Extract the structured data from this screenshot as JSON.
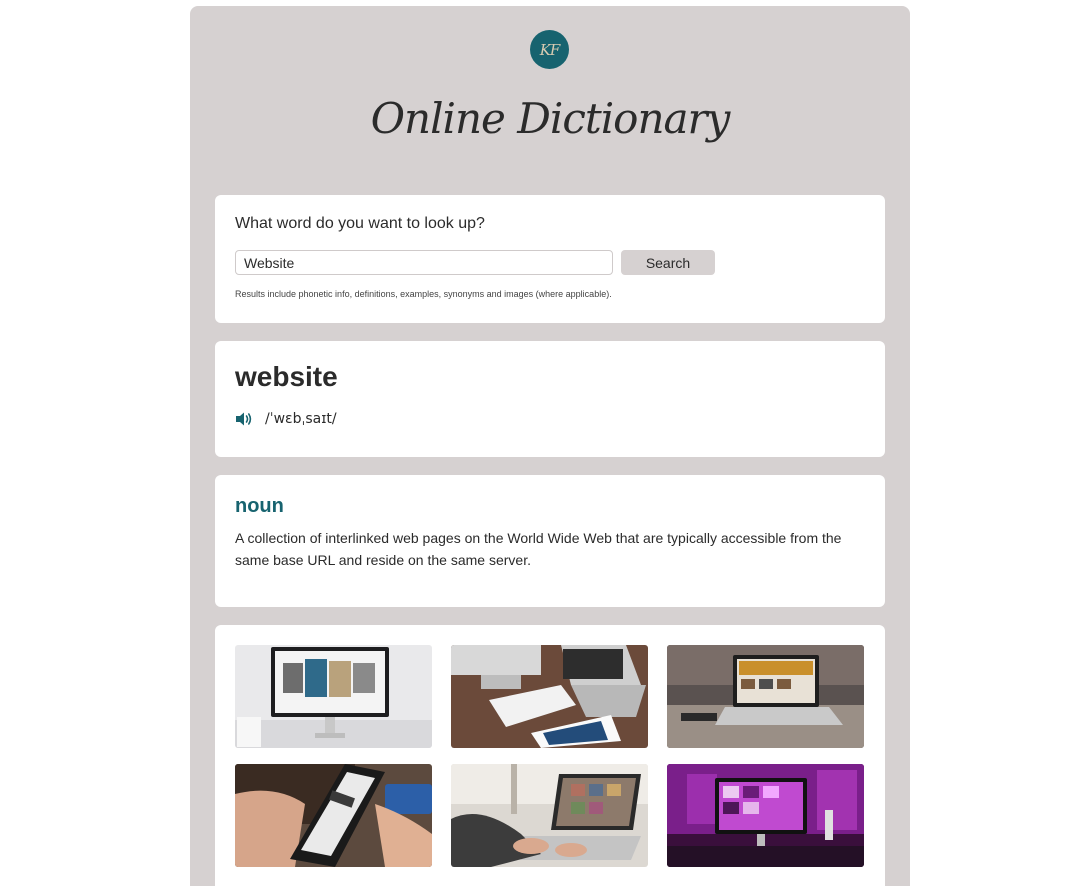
{
  "header": {
    "logo_text": "KF",
    "title": "Online Dictionary"
  },
  "search": {
    "prompt": "What word do you want to look up?",
    "value": "Website",
    "button_label": "Search",
    "hint": "Results include phonetic info, definitions, examples, synonyms and images (where applicable)."
  },
  "result": {
    "word": "website",
    "audio_icon": "speaker-icon",
    "phonetic": "/ˈwɛbˌsaɪt/"
  },
  "meaning": {
    "part_of_speech": "noun",
    "definition": "A collection of interlinked web pages on the World Wide Web that are typically accessible from the same base URL and reside on the same server."
  },
  "images": [
    {
      "name": "photo-monitor-art-gallery"
    },
    {
      "name": "photo-desk-imac-laptop-tablet"
    },
    {
      "name": "photo-laptop-on-wooden-table"
    },
    {
      "name": "photo-phone-online-shopping"
    },
    {
      "name": "photo-hands-typing-laptop"
    },
    {
      "name": "photo-pink-lit-desk-setup"
    }
  ],
  "colors": {
    "accent": "#17636f",
    "panel": "#d6d1d1",
    "card": "#ffffff"
  }
}
